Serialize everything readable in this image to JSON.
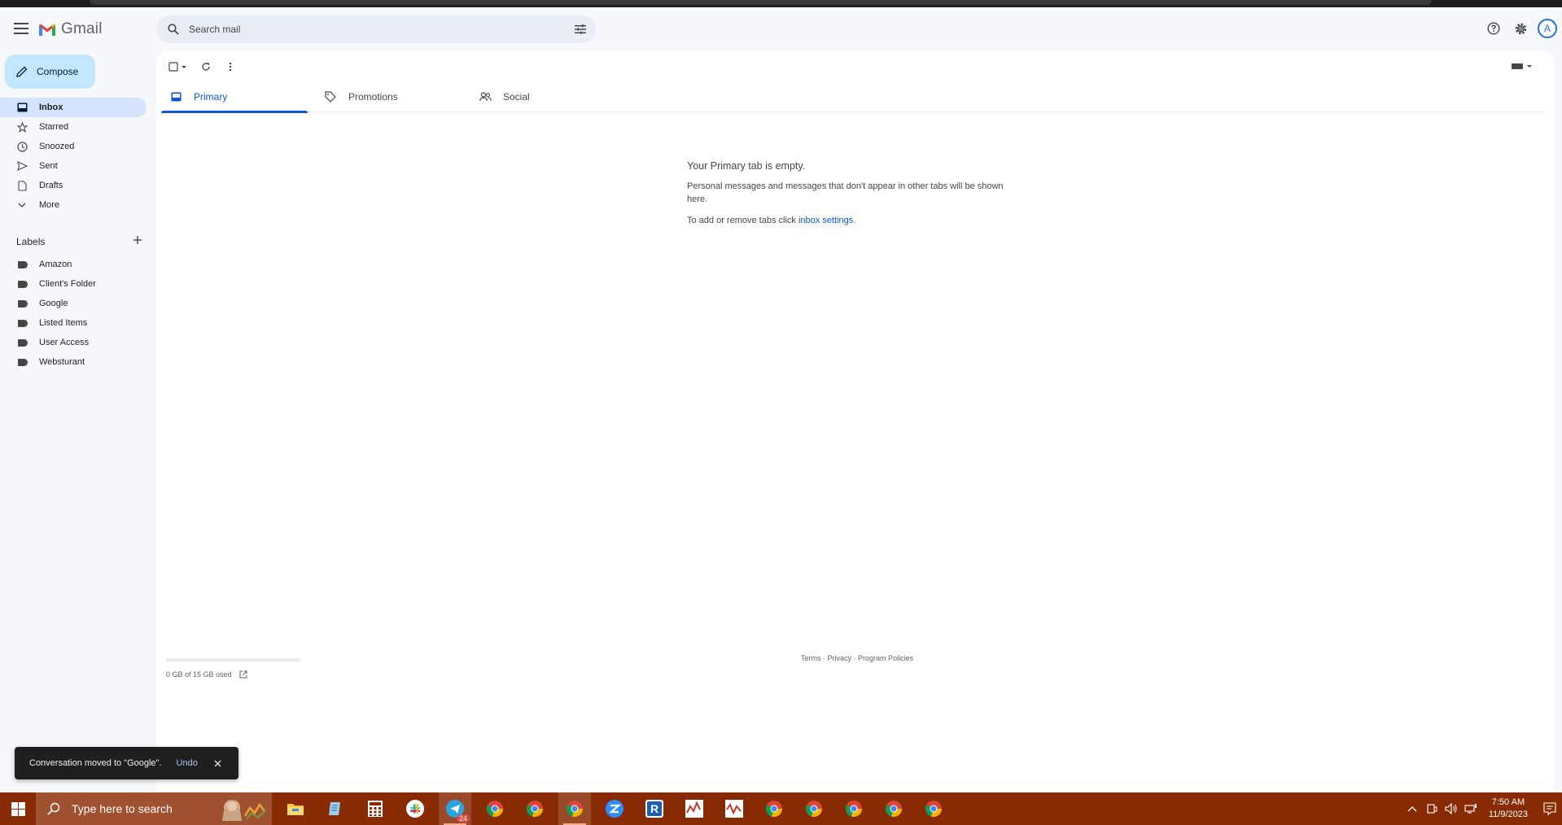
{
  "header": {
    "app_name": "Gmail",
    "search_placeholder": "Search mail",
    "avatar_letter": "A"
  },
  "sidebar": {
    "compose_label": "Compose",
    "nav": [
      {
        "label": "Inbox",
        "icon": "inbox-icon",
        "active": true
      },
      {
        "label": "Starred",
        "icon": "star-icon"
      },
      {
        "label": "Snoozed",
        "icon": "clock-icon"
      },
      {
        "label": "Sent",
        "icon": "send-icon"
      },
      {
        "label": "Drafts",
        "icon": "draft-icon"
      },
      {
        "label": "More",
        "icon": "chevron-down-icon"
      }
    ],
    "labels_title": "Labels",
    "labels": [
      "Amazon",
      "Client's Folder",
      "Google",
      "Listed Items",
      "User Access",
      "Websturant"
    ]
  },
  "tabs": [
    {
      "label": "Primary",
      "active": true
    },
    {
      "label": "Promotions"
    },
    {
      "label": "Social"
    }
  ],
  "empty_state": {
    "heading": "Your Primary tab is empty.",
    "body": "Personal messages and messages that don't appear in other tabs will be shown here.",
    "settings_prefix": "To add or remove tabs click ",
    "settings_link": "inbox settings",
    "settings_suffix": "."
  },
  "footer": {
    "storage": "0 GB of 15 GB used",
    "terms": "Terms",
    "privacy": "Privacy",
    "policies": "Program Policies",
    "sep": " · "
  },
  "snackbar": {
    "message": "Conversation moved to \"Google\".",
    "undo": "Undo"
  },
  "taskbar": {
    "search_placeholder": "Type here to search",
    "badge": "24",
    "time": "7:50 AM",
    "date": "11/9/2023"
  },
  "colors": {
    "accent": "#0b57d0",
    "compose_bg": "#c2e7ff",
    "active_nav_bg": "#d3e3fd",
    "taskbar_bg": "#882b05"
  }
}
